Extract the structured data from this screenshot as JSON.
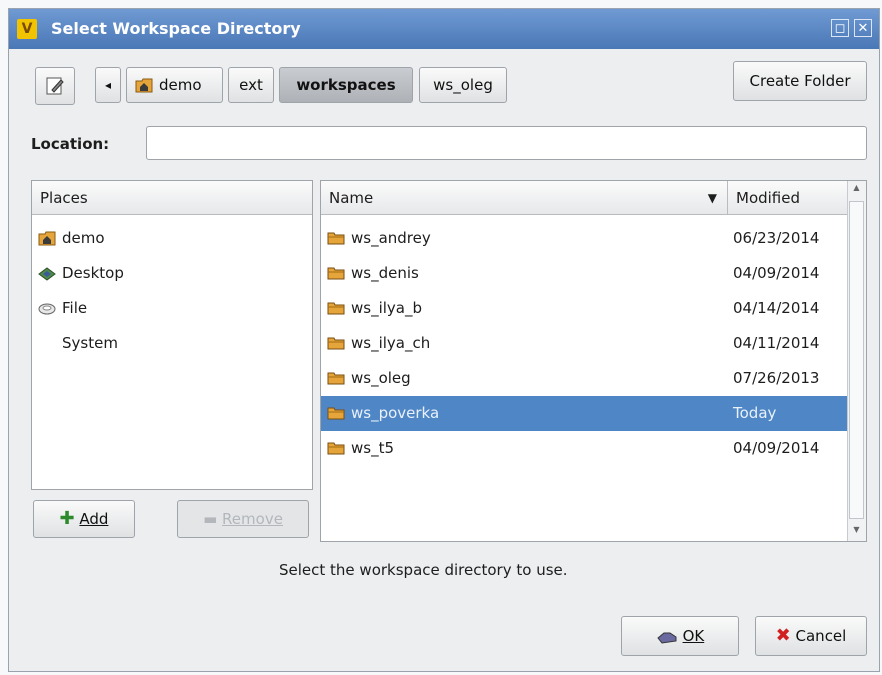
{
  "window": {
    "title": "Select Workspace Directory",
    "maximize_glyph": "◻",
    "close_glyph": "✕"
  },
  "toolbar": {
    "edit_icon": "pencil-edit-icon",
    "back_glyph": "◂",
    "crumbs": [
      "demo",
      "ext",
      "workspaces",
      "ws_oleg"
    ],
    "active_crumb": "workspaces",
    "create_folder_label": "Create Folder"
  },
  "location": {
    "label": "Location:",
    "value": "",
    "placeholder": ""
  },
  "places": {
    "header": "Places",
    "items": [
      {
        "label": "demo",
        "icon": "home-folder-icon"
      },
      {
        "label": "Desktop",
        "icon": "desktop-icon"
      },
      {
        "label": "File System",
        "icon": "drive-icon"
      }
    ],
    "add_label": "Add",
    "remove_label": "Remove"
  },
  "files": {
    "col_name": "Name",
    "col_modified": "Modified",
    "sort_glyph": "▼",
    "rows": [
      {
        "name": "ws_andrey",
        "modified": "06/23/2014"
      },
      {
        "name": "ws_denis",
        "modified": "04/09/2014"
      },
      {
        "name": "ws_ilya_b",
        "modified": "04/14/2014"
      },
      {
        "name": "ws_ilya_ch",
        "modified": "04/11/2014"
      },
      {
        "name": "ws_oleg",
        "modified": "07/26/2013"
      },
      {
        "name": "ws_poverka",
        "modified": "Today"
      },
      {
        "name": "ws_t5",
        "modified": "04/09/2014"
      }
    ],
    "selected_index": 5
  },
  "hint": "Select the workspace directory to use.",
  "buttons": {
    "ok_label": "OK",
    "cancel_label": "Cancel"
  },
  "colors": {
    "title_bar": "#4a77b6",
    "selection": "#4f86c6",
    "folder": "#e6a53a"
  }
}
